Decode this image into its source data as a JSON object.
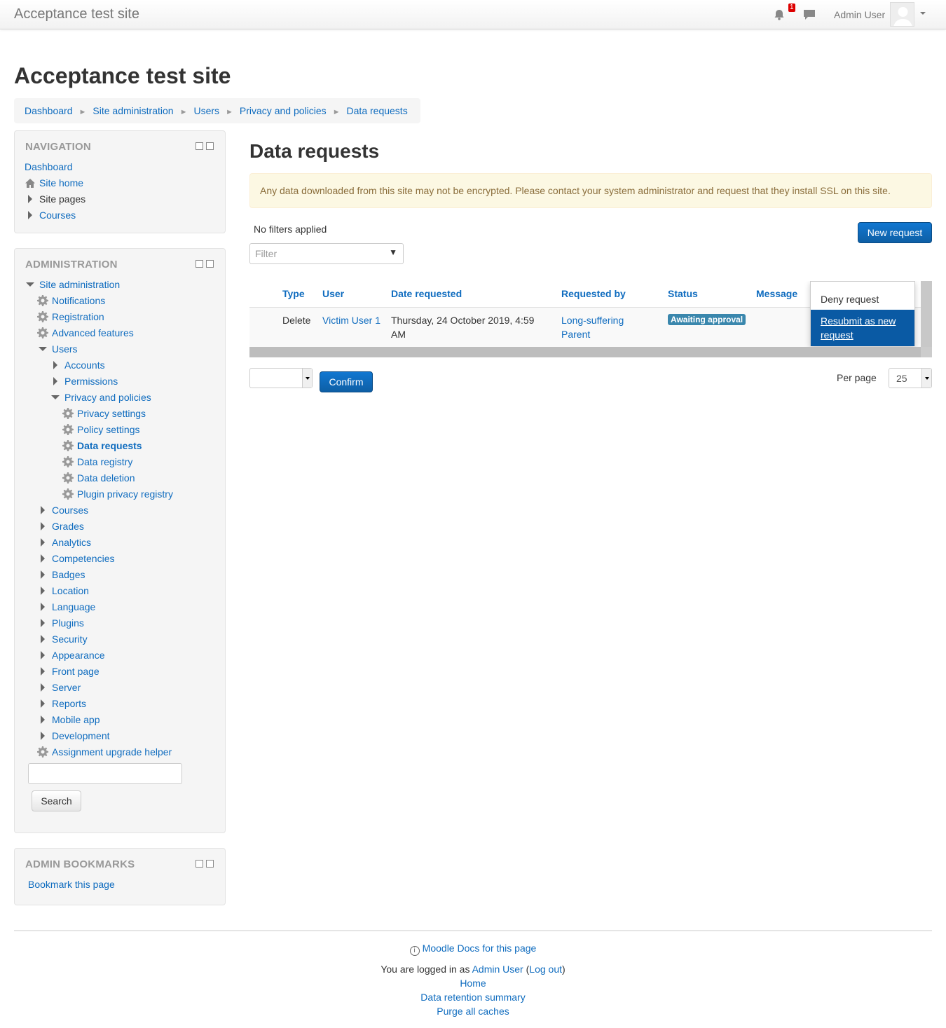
{
  "navbar": {
    "brand": "Acceptance test site",
    "notification_count": "1",
    "user_name": "Admin User"
  },
  "header": {
    "site_title": "Acceptance test site"
  },
  "breadcrumb": [
    "Dashboard",
    "Site administration",
    "Users",
    "Privacy and policies",
    "Data requests"
  ],
  "navigation_block": {
    "title": "Navigation",
    "items": [
      "Dashboard",
      "Site home",
      "Site pages",
      "Courses"
    ]
  },
  "admin_block": {
    "title": "Administration",
    "root": "Site administration",
    "notifications": "Notifications",
    "registration": "Registration",
    "advanced_features": "Advanced features",
    "users": "Users",
    "accounts": "Accounts",
    "permissions": "Permissions",
    "privacy_and_policies": "Privacy and policies",
    "privacy_settings": "Privacy settings",
    "policy_settings": "Policy settings",
    "data_requests": "Data requests",
    "data_registry": "Data registry",
    "data_deletion": "Data deletion",
    "plugin_privacy_registry": "Plugin privacy registry",
    "categories": [
      "Courses",
      "Grades",
      "Analytics",
      "Competencies",
      "Badges",
      "Location",
      "Language",
      "Plugins",
      "Security",
      "Appearance",
      "Front page",
      "Server",
      "Reports",
      "Mobile app",
      "Development"
    ],
    "assignment_upgrade_helper": "Assignment upgrade helper",
    "search_button": "Search"
  },
  "bookmarks_block": {
    "title": "Admin bookmarks",
    "link": "Bookmark this page"
  },
  "main": {
    "title": "Data requests",
    "ssl_warning": "Any data downloaded from this site may not be encrypted. Please contact your system administrator and request that they install SSL on this site.",
    "filters_status": "No filters applied",
    "new_request_button": "New request",
    "filter_placeholder": "Filter",
    "table": {
      "headers": [
        "Type",
        "User",
        "Date requested",
        "Requested by",
        "Status",
        "Message"
      ],
      "row": {
        "type": "Delete",
        "user": "Victim User 1",
        "date_requested": "Thursday, 24 October 2019, 4:59 AM",
        "requested_by": "Long-suffering Parent",
        "status": "Awaiting approval",
        "message": ""
      }
    },
    "action_menu": [
      "Deny request",
      "Resubmit as new request"
    ],
    "confirm_button": "Confirm",
    "per_page_label": "Per page",
    "per_page_value": "25"
  },
  "footer": {
    "docs_link": "Moodle Docs for this page",
    "logged_in_prefix": "You are logged in as ",
    "logged_in_user": "Admin User",
    "logout": "Log out",
    "home": "Home",
    "data_retention": "Data retention summary",
    "purge_caches": "Purge all caches"
  }
}
